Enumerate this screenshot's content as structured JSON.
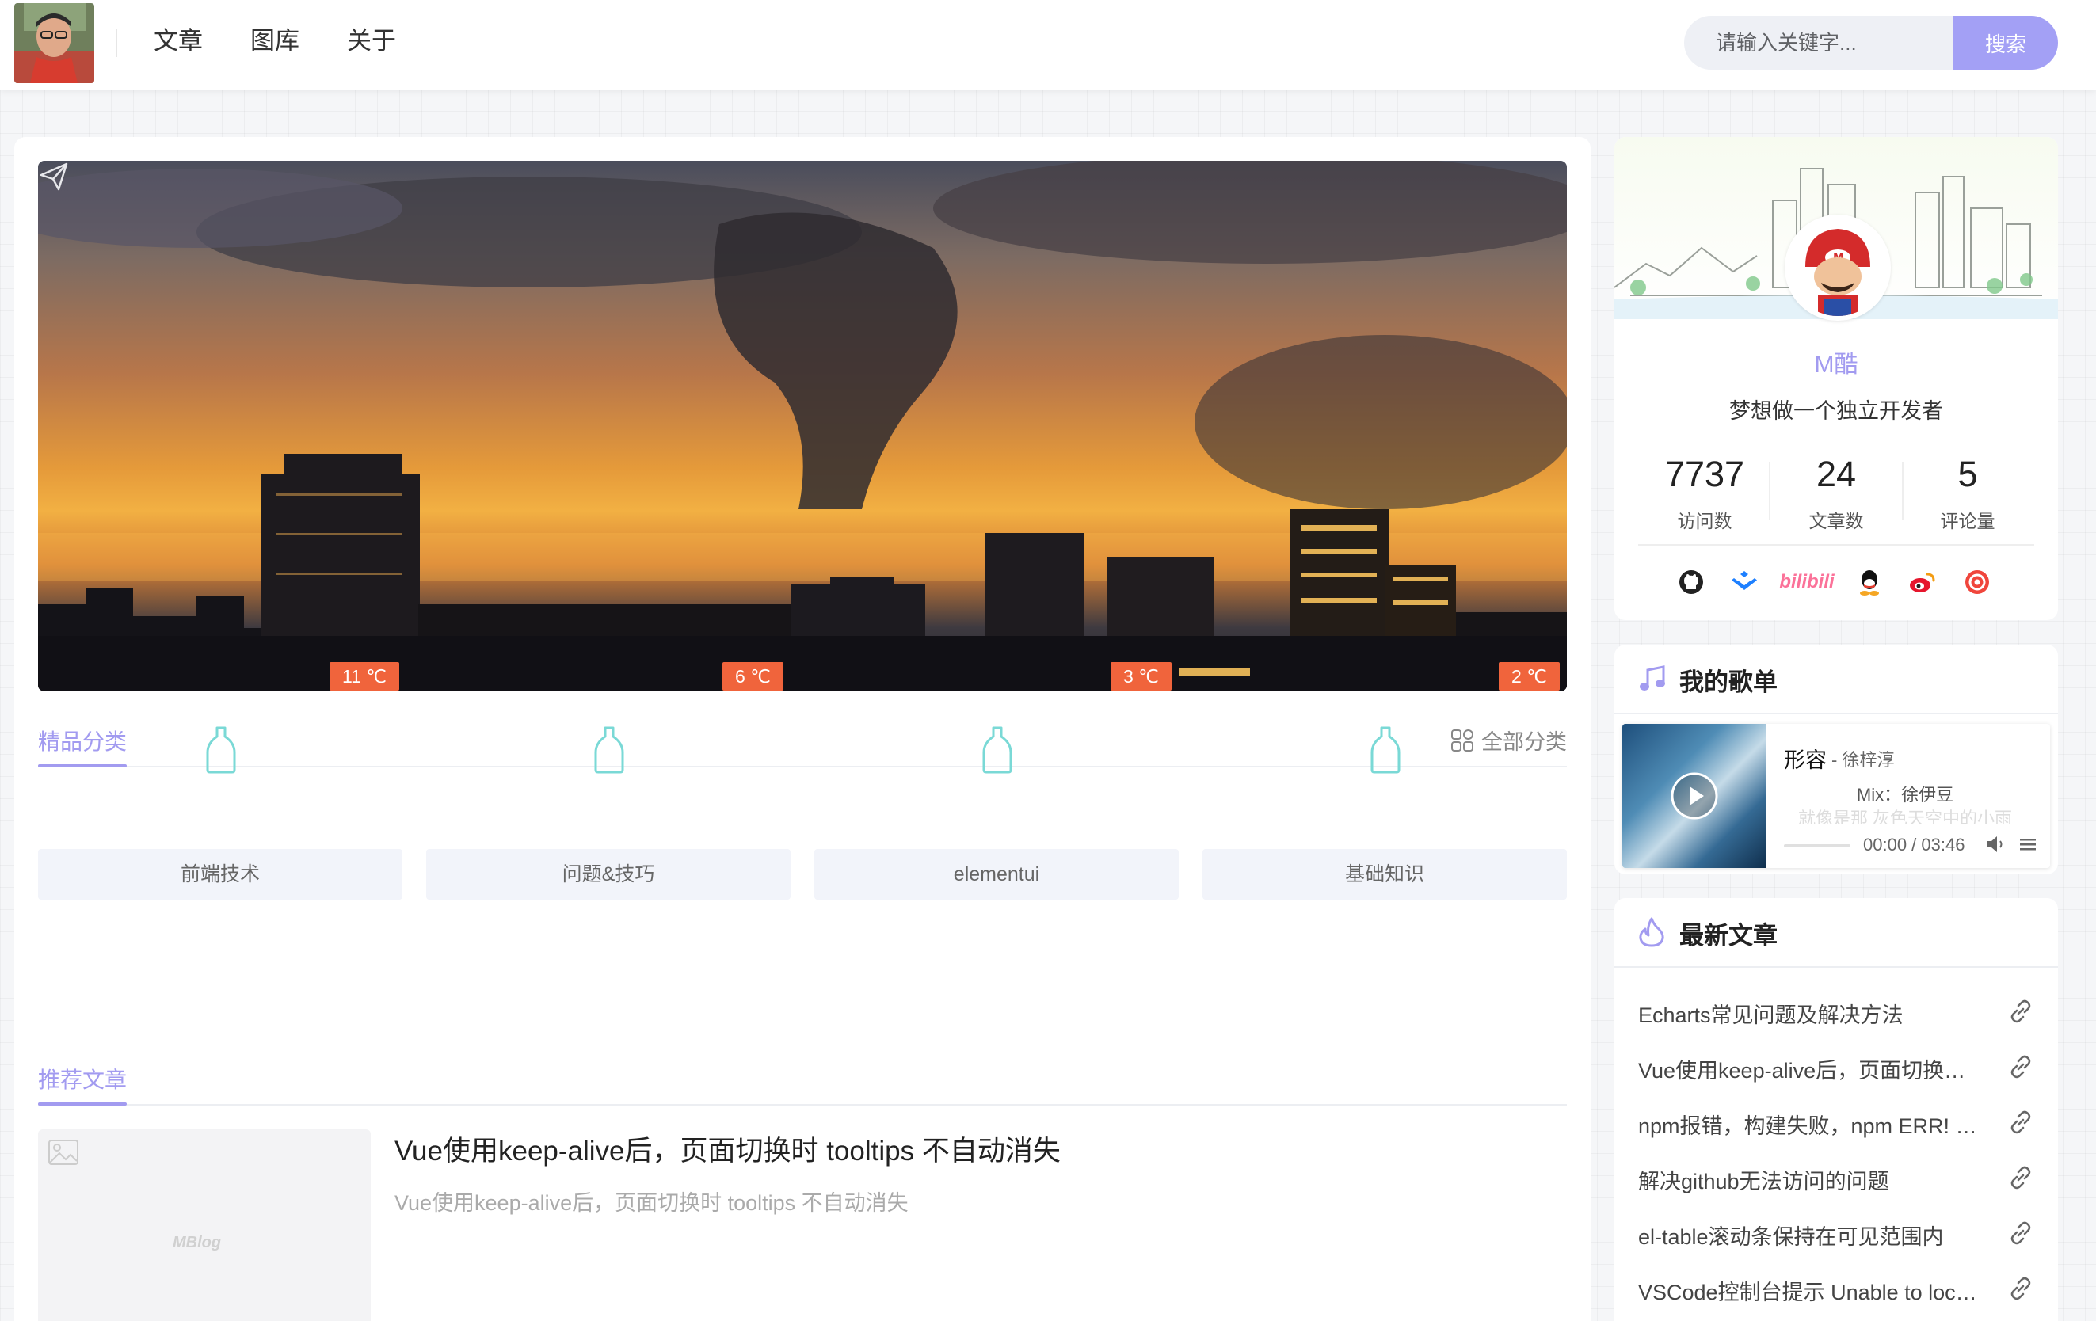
{
  "header": {
    "nav": [
      "文章",
      "图库",
      "关于"
    ],
    "search_placeholder": "请输入关键字...",
    "search_button": "搜索"
  },
  "main": {
    "featured_tab": "精品分类",
    "all_categories": "全部分类",
    "categories": [
      {
        "name": "前端技术",
        "temp": "11 ℃"
      },
      {
        "name": "问题&技巧",
        "temp": "6 ℃"
      },
      {
        "name": "elementui",
        "temp": "3 ℃"
      },
      {
        "name": "基础知识",
        "temp": "2 ℃"
      }
    ],
    "recommend_tab": "推荐文章",
    "article": {
      "title": "Vue使用keep-alive后，页面切换时 tooltips 不自动消失",
      "summary": "Vue使用keep-alive后，页面切换时 tooltips 不自动消失",
      "placeholder_watermark": "MBlog"
    }
  },
  "profile": {
    "name": "M酷",
    "motto": "梦想做一个独立开发者",
    "stats": [
      {
        "value": "7737",
        "label": "访问数"
      },
      {
        "value": "24",
        "label": "文章数"
      },
      {
        "value": "5",
        "label": "评论量"
      }
    ],
    "socials": [
      "github-icon",
      "juejin-icon",
      "bilibili-icon",
      "qq-icon",
      "weibo-icon",
      "email-icon"
    ],
    "bilibili_text": "bilibili"
  },
  "playlist": {
    "title": "我的歌单",
    "song": "形容",
    "artist": "- 徐梓淳",
    "lyric_line1": "Mix：徐伊豆",
    "lyric_line2": "就像是那 灰色天空中的小雨",
    "time": "00:00 / 03:46",
    "progress": 0.0
  },
  "latest": {
    "title": "最新文章",
    "items": [
      "Echarts常见问题及解决方法",
      "Vue使用keep-alive后，页面切换时 tooltips 不自动消失",
      "npm报错，构建失败，npm ERR! code ELIFECYCLE",
      "解决github无法访问的问题",
      "el-table滚动条保持在可见范围内",
      "VSCode控制台提示 Unable to locate"
    ]
  },
  "colors": {
    "accent": "#a29bf0",
    "badge": "#f0643c",
    "icon_teal": "#7ad9d6"
  }
}
